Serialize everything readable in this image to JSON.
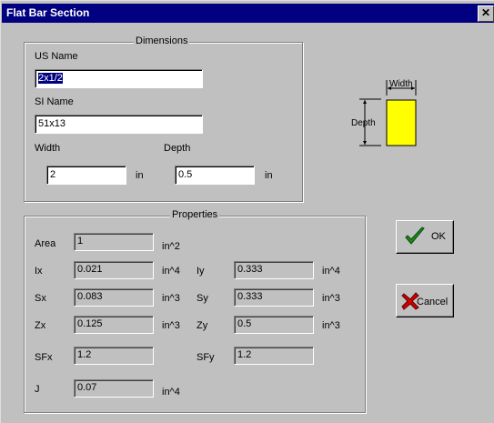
{
  "window": {
    "title": "Flat Bar Section",
    "close_glyph": "✕"
  },
  "dimensions": {
    "group_title": "Dimensions",
    "us_name_label": "US Name",
    "us_name_value": "2x1/2",
    "si_name_label": "SI Name",
    "si_name_value": "51x13",
    "width_label": "Width",
    "width_value": "2",
    "width_unit": "in",
    "depth_label": "Depth",
    "depth_value": "0.5",
    "depth_unit": "in"
  },
  "diagram": {
    "width_label": "Width",
    "depth_label": "Depth",
    "fill_color": "#ffff00"
  },
  "properties": {
    "group_title": "Properties",
    "area": {
      "label": "Area",
      "value": "1",
      "unit": "in^2"
    },
    "ix": {
      "label": "Ix",
      "value": "0.021",
      "unit": "in^4"
    },
    "iy": {
      "label": "Iy",
      "value": "0.333",
      "unit": "in^4"
    },
    "sx": {
      "label": "Sx",
      "value": "0.083",
      "unit": "in^3"
    },
    "sy": {
      "label": "Sy",
      "value": "0.333",
      "unit": "in^3"
    },
    "zx": {
      "label": "Zx",
      "value": "0.125",
      "unit": "in^3"
    },
    "zy": {
      "label": "Zy",
      "value": "0.5",
      "unit": "in^3"
    },
    "sfx": {
      "label": "SFx",
      "value": "1.2"
    },
    "sfy": {
      "label": "SFy",
      "value": "1.2"
    },
    "j": {
      "label": "J",
      "value": "0.07",
      "unit": "in^4"
    }
  },
  "buttons": {
    "ok_label": "OK",
    "cancel_label": "Cancel",
    "ok_icon": "checkmark-icon",
    "cancel_icon": "red-x-icon"
  }
}
